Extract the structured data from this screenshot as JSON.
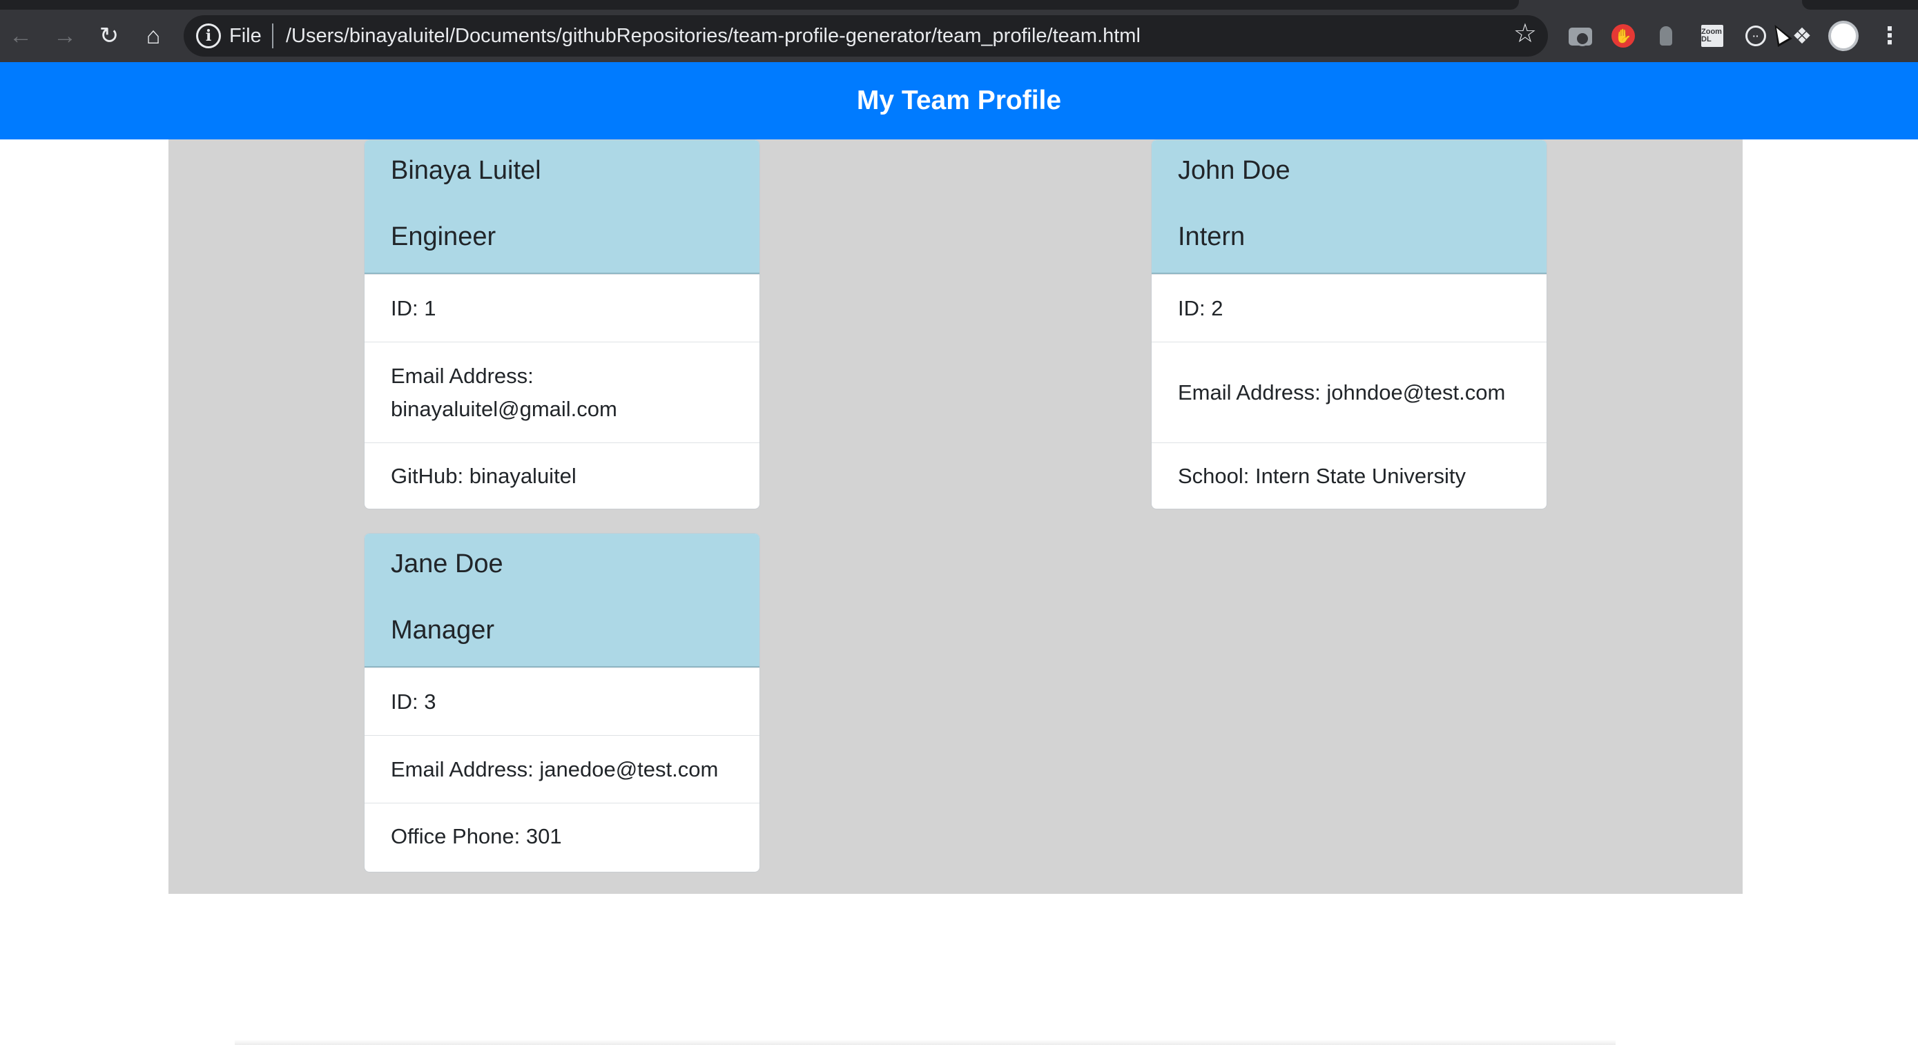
{
  "browser": {
    "omnibox": {
      "scheme_label": "File",
      "url": "/Users/binayaluitel/Documents/githubRepositories/team-profile-generator/team_profile/team.html"
    },
    "icons": [
      "back-icon",
      "forward-icon",
      "reload-icon",
      "home-icon",
      "info-icon",
      "bookmark-star-icon",
      "camera-extension-icon",
      "stop-extension-icon",
      "extension-icon",
      "zoom-extension-icon",
      "round-extension-icon",
      "puzzle-extensions-icon",
      "profile-avatar",
      "more-menu-icon"
    ],
    "zoom_extension_label": "Zoom DL"
  },
  "header": {
    "title": "My Team Profile",
    "background": "#007bff"
  },
  "cards": [
    {
      "name": "Binaya Luitel",
      "role": "Engineer",
      "id_text": "ID: 1",
      "email_text": "Email Address: binayaluitel@gmail.com",
      "extra_text": "GitHub: binayaluitel"
    },
    {
      "name": "John Doe",
      "role": "Intern",
      "id_text": "ID: 2",
      "email_text": "Email Address: johndoe@test.com",
      "extra_text": "School: Intern State University"
    },
    {
      "name": "Jane Doe",
      "role": "Manager",
      "id_text": "ID: 3",
      "email_text": "Email Address: janedoe@test.com",
      "extra_text": "Office Phone: 301"
    }
  ],
  "colors": {
    "card_header": "#add8e6",
    "content_background": "#d3d3d3"
  }
}
